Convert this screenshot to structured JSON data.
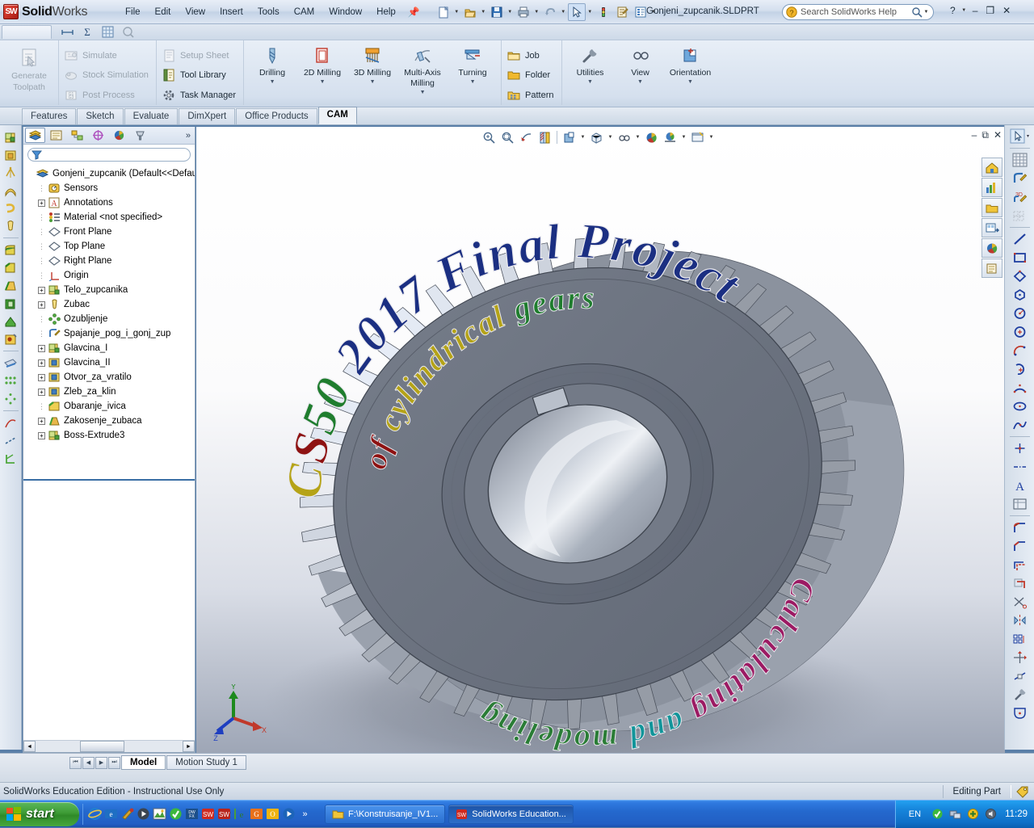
{
  "app": {
    "brand_bold": "Solid",
    "brand_light": "Works",
    "document_title": "Gonjeni_zupcanik.SLDPRT"
  },
  "menu": {
    "items": [
      "File",
      "Edit",
      "View",
      "Insert",
      "Tools",
      "CAM",
      "Window",
      "Help"
    ]
  },
  "search": {
    "placeholder": "Search SolidWorks Help"
  },
  "window_controls": {
    "help": "?",
    "minimize": "–",
    "restore": "❐",
    "close": "✕"
  },
  "ribbon": {
    "generate_toolpath": "Generate\nToolpath",
    "generate_toolpath_l1": "Generate",
    "generate_toolpath_l2": "Toolpath",
    "simulate": "Simulate",
    "stock_simulation": "Stock Simulation",
    "post_process": "Post Process",
    "setup_sheet": "Setup Sheet",
    "tool_library": "Tool Library",
    "task_manager": "Task Manager",
    "drilling": "Drilling",
    "milling_2d": "2D Milling",
    "milling_3d": "3D Milling",
    "multi_axis_l1": "Multi-Axis",
    "multi_axis_l2": "Milling",
    "turning": "Turning",
    "job": "Job",
    "folder": "Folder",
    "pattern": "Pattern",
    "utilities": "Utilities",
    "view": "View",
    "orientation": "Orientation"
  },
  "command_tabs": [
    {
      "label": "Features",
      "active": false
    },
    {
      "label": "Sketch",
      "active": false
    },
    {
      "label": "Evaluate",
      "active": false
    },
    {
      "label": "DimXpert",
      "active": false
    },
    {
      "label": "Office Products",
      "active": false
    },
    {
      "label": "CAM",
      "active": true
    }
  ],
  "feature_tree": {
    "filter_placeholder": "",
    "root": "Gonjeni_zupcanik  (Default<<Default>",
    "items": [
      {
        "label": "Sensors",
        "expand": "none",
        "icon": "sensor-icon"
      },
      {
        "label": "Annotations",
        "expand": "plus",
        "icon": "annotations-icon"
      },
      {
        "label": "Material <not specified>",
        "expand": "none",
        "icon": "material-icon"
      },
      {
        "label": "Front Plane",
        "expand": "none",
        "icon": "plane-icon"
      },
      {
        "label": "Top Plane",
        "expand": "none",
        "icon": "plane-icon"
      },
      {
        "label": "Right Plane",
        "expand": "none",
        "icon": "plane-icon"
      },
      {
        "label": "Origin",
        "expand": "none",
        "icon": "origin-icon"
      },
      {
        "label": "Telo_zupcanika",
        "expand": "plus",
        "icon": "extrude-icon"
      },
      {
        "label": "Zubac",
        "expand": "plus",
        "icon": "revolve-cut-icon"
      },
      {
        "label": "Ozubljenje",
        "expand": "none",
        "icon": "circular-pattern-icon"
      },
      {
        "label": "Spajanje_pog_i_gonj_zup",
        "expand": "none",
        "icon": "sketch-icon"
      },
      {
        "label": "Glavcina_I",
        "expand": "plus",
        "icon": "extrude-icon"
      },
      {
        "label": "Glavcina_II",
        "expand": "plus",
        "icon": "cut-extrude-icon"
      },
      {
        "label": "Otvor_za_vratilo",
        "expand": "plus",
        "icon": "cut-extrude-icon"
      },
      {
        "label": "Zleb_za_klin",
        "expand": "plus",
        "icon": "cut-extrude-icon"
      },
      {
        "label": "Obaranje_ivica",
        "expand": "none",
        "icon": "chamfer-icon"
      },
      {
        "label": "Zakosenje_zubaca",
        "expand": "plus",
        "icon": "draft-icon"
      },
      {
        "label": "Boss-Extrude3",
        "expand": "plus",
        "icon": "extrude-icon"
      }
    ]
  },
  "model": {
    "ring_text_top": "CS50 2017 Final Project",
    "inner_text_top": "of cylindrical gears",
    "inner_text_bottom": "Calculating and modeling",
    "triad": {
      "x": "X",
      "y": "Y",
      "z": "Z"
    }
  },
  "bottom_tabs": [
    {
      "label": "Model",
      "active": true
    },
    {
      "label": "Motion Study 1",
      "active": false
    }
  ],
  "status": {
    "edition": "SolidWorks Education Edition - Instructional Use Only",
    "mode": "Editing Part"
  },
  "taskbar": {
    "start": "start",
    "items": [
      {
        "label": "F:\\Konstruisanje_IV1...",
        "active": false,
        "icon": "folder-icon"
      },
      {
        "label": "SolidWorks Education...",
        "active": true,
        "icon": "solidworks-icon"
      }
    ],
    "quick_launch_overflow": "»",
    "language": "EN",
    "clock": "11:29"
  },
  "colors": {
    "accent_blue": "#2468cd",
    "brand_red": "#c0392b",
    "gear_body": "#6b7280",
    "text_navy": "#1c2f7a",
    "text_green": "#1a7a2e",
    "text_yellow": "#b8a00a",
    "text_red": "#9e1414",
    "text_magenta": "#a01a64",
    "text_teal": "#109c9c"
  }
}
